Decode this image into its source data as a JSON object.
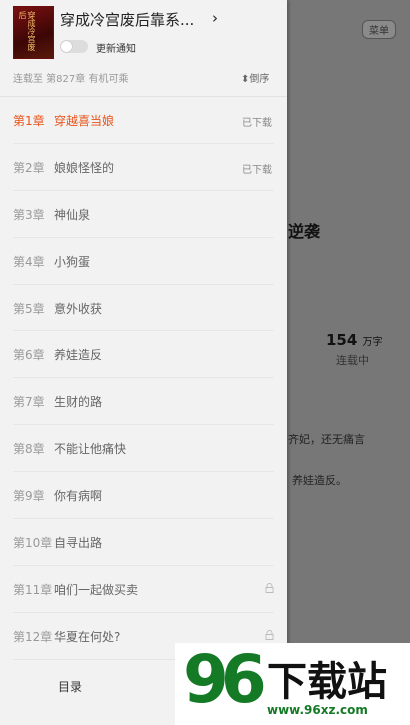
{
  "background": {
    "button": "菜单",
    "title_fragment": "逆袭",
    "word_count": "154",
    "word_unit": "万字",
    "serial_status": "连载中",
    "desc_line1": "齐妃，还无痛言",
    "desc_line2": "养娃造反。"
  },
  "drawer": {
    "book_title": "穿成冷宫废后靠系...",
    "title_chevron": "›",
    "cover_text": "穿成冷宫废后",
    "notify_label": "更新通知",
    "notify_on": false,
    "status_text": "连载至  第827章  有机可乘",
    "sort_label": "倒序",
    "sort_icon": "⬍",
    "chapters": [
      {
        "num": "第1章",
        "title": "穿越喜当娘",
        "status": "已下载",
        "current": true,
        "locked": false
      },
      {
        "num": "第2章",
        "title": "娘娘怪怪的",
        "status": "已下载",
        "current": false,
        "locked": false
      },
      {
        "num": "第3章",
        "title": "神仙泉",
        "status": "",
        "current": false,
        "locked": false
      },
      {
        "num": "第4章",
        "title": "小狗蛋",
        "status": "",
        "current": false,
        "locked": false
      },
      {
        "num": "第5章",
        "title": "意外收获",
        "status": "",
        "current": false,
        "locked": false
      },
      {
        "num": "第6章",
        "title": "养娃造反",
        "status": "",
        "current": false,
        "locked": false
      },
      {
        "num": "第7章",
        "title": "生财的路",
        "status": "",
        "current": false,
        "locked": false
      },
      {
        "num": "第8章",
        "title": "不能让他痛快",
        "status": "",
        "current": false,
        "locked": false
      },
      {
        "num": "第9章",
        "title": "你有病啊",
        "status": "",
        "current": false,
        "locked": false
      },
      {
        "num": "第10章",
        "title": "自寻出路",
        "status": "",
        "current": false,
        "locked": false
      },
      {
        "num": "第11章",
        "title": "咱们一起做买卖",
        "status": "",
        "current": false,
        "locked": true
      },
      {
        "num": "第12章",
        "title": "华夏在何处?",
        "status": "",
        "current": false,
        "locked": true
      }
    ],
    "footer_label": "目录"
  },
  "watermark": {
    "number": "96",
    "text": "下载站",
    "url": "www.96xz.com"
  }
}
